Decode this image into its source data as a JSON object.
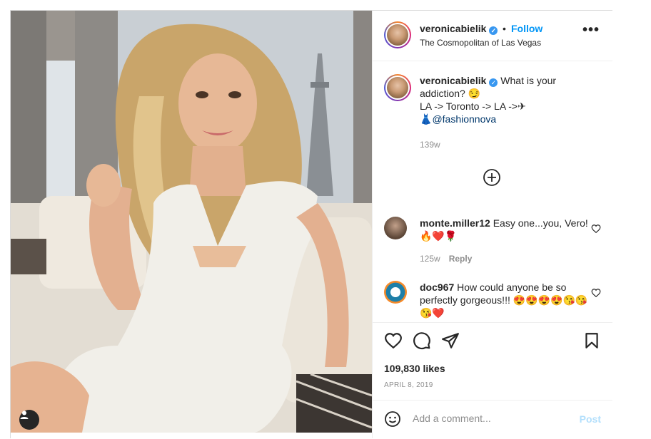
{
  "post": {
    "author": "veronicabielik",
    "verified": true,
    "follow_label": "Follow",
    "separator": "•",
    "location": "The Cosmopolitan of Las Vegas",
    "more_label": "•••"
  },
  "caption": {
    "username": "veronicabielik",
    "line1": "What is your addiction? 😏",
    "line2": "LA -> Toronto -> LA ->✈",
    "line3_emoji": "👗",
    "mention": "@fashionnova",
    "age": "139w"
  },
  "comments": [
    {
      "username": "monte.miller12",
      "text": "Easy one...you, Vero! 🔥❤️🌹",
      "age": "125w",
      "reply_label": "Reply"
    },
    {
      "username": "doc967",
      "text": "How could anyone be so perfectly gorgeous!!! 😍😍😍😍😘😘😘❤️"
    }
  ],
  "likes": "109,830 likes",
  "date": "APRIL 8, 2019",
  "add_comment": {
    "placeholder": "Add a comment...",
    "post_label": "Post"
  },
  "icons": {
    "like": "heart-icon",
    "comment": "comment-icon",
    "share": "paper-plane-icon",
    "save": "bookmark-icon",
    "load_more": "plus-circle-icon",
    "emoji": "smiley-icon",
    "user_tag": "user-icon"
  },
  "colors": {
    "link": "#0095f6",
    "post_disabled": "#b2dffc",
    "verified": "#3897f0",
    "mention": "#00376b"
  }
}
